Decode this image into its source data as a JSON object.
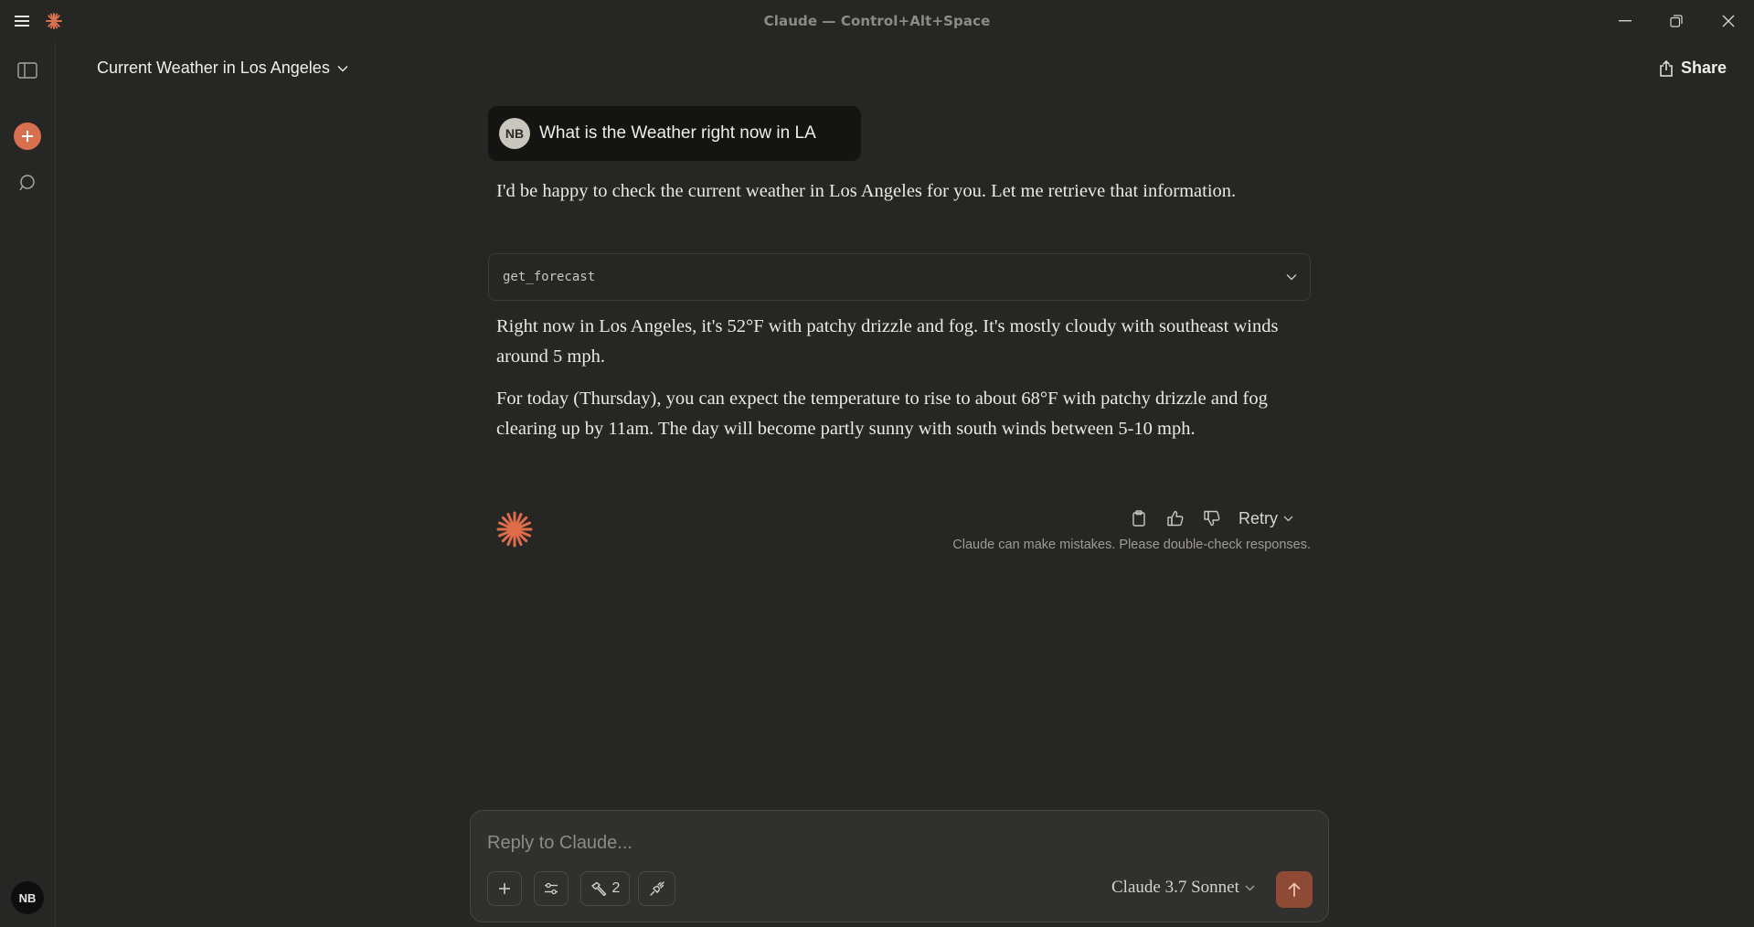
{
  "window": {
    "title": "Claude — Control+Alt+Space",
    "icons": [
      "menu-icon",
      "claude-logo-icon",
      "minimize-icon",
      "restore-icon",
      "close-icon"
    ]
  },
  "sidebar": {
    "user_initials": "NB",
    "icons": [
      "sidebar-toggle-icon",
      "plus-icon",
      "search-icon"
    ],
    "accent_color": "#d8704f"
  },
  "header": {
    "conversation_title": "Current Weather in Los Angeles",
    "share_label": "Share"
  },
  "conversation": {
    "user_message": {
      "initials": "NB",
      "text": "What is the Weather right now in LA"
    },
    "assistant": {
      "intro": "I'd be happy to check the current weather in Los Angeles for you. Let me retrieve that information.",
      "tool_call": "get_forecast",
      "paragraph_1": "Right now in Los Angeles, it's 52°F with patchy drizzle and fog. It's mostly cloudy with southeast winds around 5 mph.",
      "paragraph_2": "For today (Thursday), you can expect the temperature to rise to about 68°F with patchy drizzle and fog clearing up by 11am. The day will become partly sunny with south winds between 5-10 mph."
    },
    "actions": {
      "retry_label": "Retry",
      "disclaimer": "Claude can make mistakes. Please double-check responses.",
      "icons": [
        "copy-icon",
        "thumbs-up-icon",
        "thumbs-down-icon"
      ]
    }
  },
  "composer": {
    "placeholder": "Reply to Claude...",
    "tools_count": "2",
    "model": "Claude 3.7 Sonnet",
    "icons": [
      "plus-icon",
      "sliders-icon",
      "hammer-icon",
      "plug-icon",
      "arrow-up-icon"
    ],
    "send_color": "#8e4a35"
  }
}
